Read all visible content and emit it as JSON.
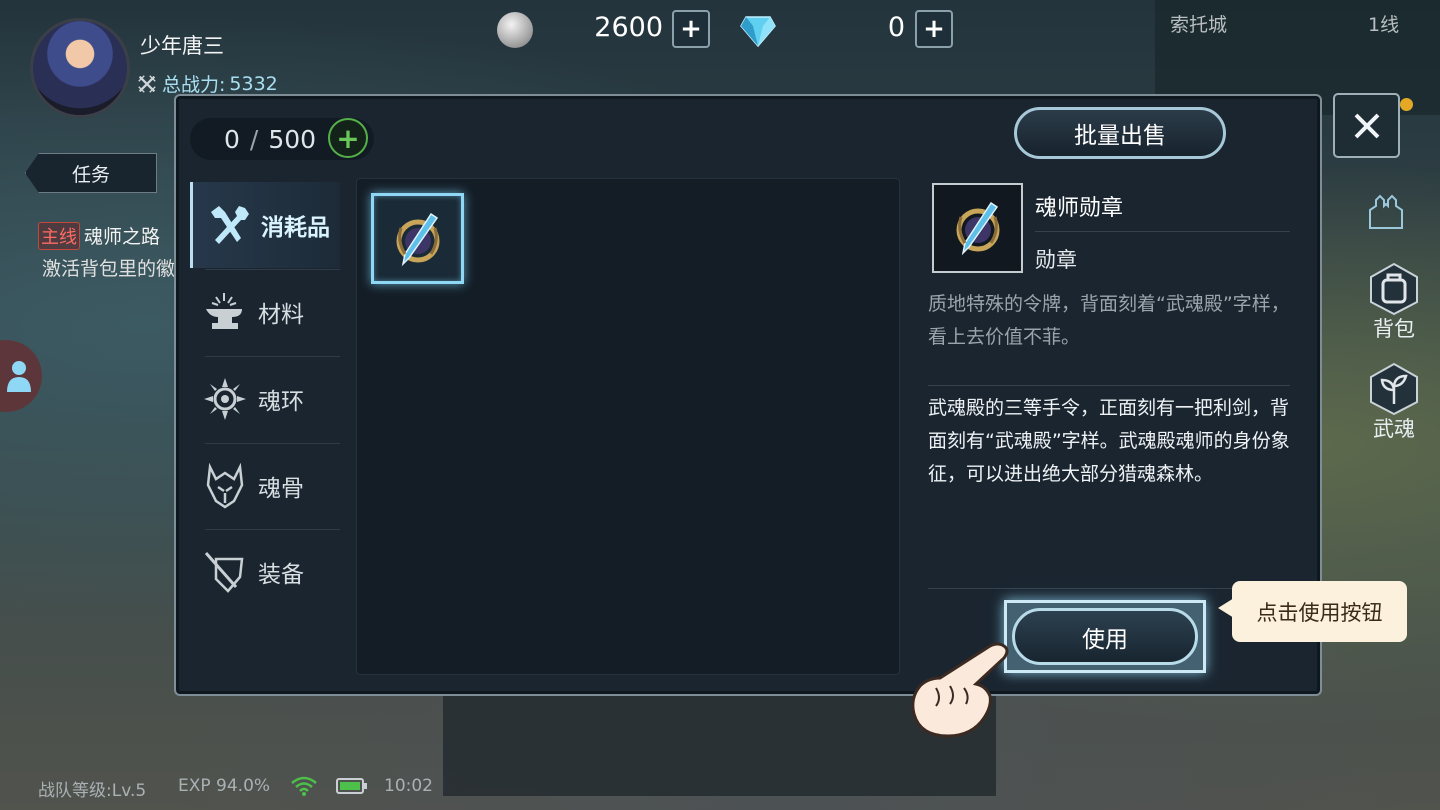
{
  "player": {
    "name": "少年唐三",
    "power_label": "总战力:",
    "power_value": "5332"
  },
  "currency": {
    "coins": "2600",
    "diamonds": "0"
  },
  "location": {
    "name": "索托城",
    "channel": "1线"
  },
  "side_buttons": {
    "bag": "背包",
    "martial_soul": "武魂"
  },
  "quest": {
    "tab_label": "任务",
    "tag": "主线",
    "title": "魂师之路",
    "desc": "激活背包里的徽"
  },
  "bag": {
    "capacity_used": "0",
    "capacity_sep": "/",
    "capacity_max": "500",
    "batch_sell_label": "批量出售",
    "categories": [
      {
        "label": "消耗品",
        "icon": "tools-icon",
        "active": true
      },
      {
        "label": "材料",
        "icon": "anvil-icon",
        "active": false
      },
      {
        "label": "魂环",
        "icon": "soul-ring-icon",
        "active": false
      },
      {
        "label": "魂骨",
        "icon": "soul-bone-icon",
        "active": false
      },
      {
        "label": "装备",
        "icon": "equipment-icon",
        "active": false
      }
    ]
  },
  "item": {
    "name": "魂师勋章",
    "type": "勋章",
    "flavor": "质地特殊的令牌，背面刻着“武魂殿”字样，看上去价值不菲。",
    "description": "武魂殿的三等手令，正面刻有一把利剑，背面刻有“武魂殿”字样。武魂殿魂师的身份象征，可以进出绝大部分猎魂森林。",
    "icon": "medal-icon"
  },
  "use_label": "使用",
  "tooltip": "点击使用按钮",
  "status_bar": {
    "team_level": "战队等级:Lv.5",
    "exp": "EXP 94.0%",
    "time": "10:02"
  },
  "colors": {
    "panel_bg": "#1a2530",
    "highlight": "#8fd8f5",
    "tooltip_bg": "#fbf1dc",
    "plus_green": "#56b04a",
    "power_text": "#a9e0f1"
  }
}
